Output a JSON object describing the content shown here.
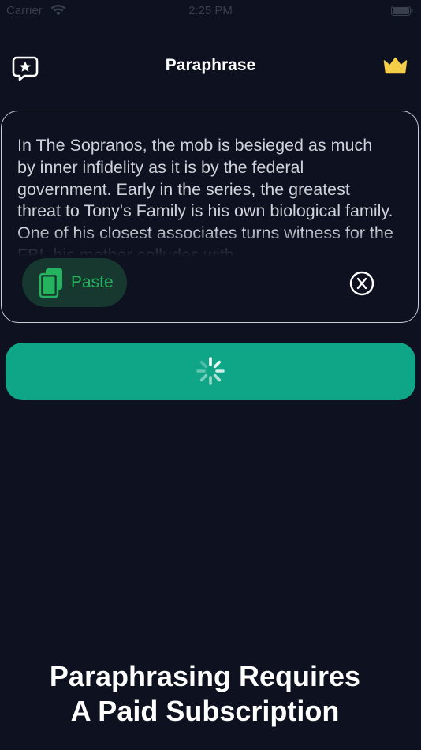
{
  "status_bar": {
    "carrier": "Carrier",
    "time": "2:25 PM",
    "wifi_icon": "wifi-icon",
    "battery_icon": "battery-icon"
  },
  "nav": {
    "title": "Paraphrase",
    "left_icon": "chat-star-icon",
    "right_icon": "crown-icon"
  },
  "input": {
    "text": "In The Sopranos, the mob is besieged as much by inner infidelity as it is by the federal government. Early in the series, the greatest threat to Tony's Family is his own biological family. One of his closest associates turns witness for the FBI, his mother colludes with"
  },
  "paste_button": {
    "label": "Paste",
    "icon": "clipboard-icon"
  },
  "clear_button": {
    "icon": "close-circle-icon"
  },
  "paraphrase_button": {
    "state": "loading",
    "icon": "spinner-icon"
  },
  "message": {
    "line1": "Paraphrasing Requires",
    "line2": "A Paid Subscription"
  },
  "colors": {
    "background": "#0d1120",
    "accent": "#0ea686",
    "paste_bg": "#16382f",
    "paste_text": "#25b35f",
    "crown": "#f4ce46"
  }
}
